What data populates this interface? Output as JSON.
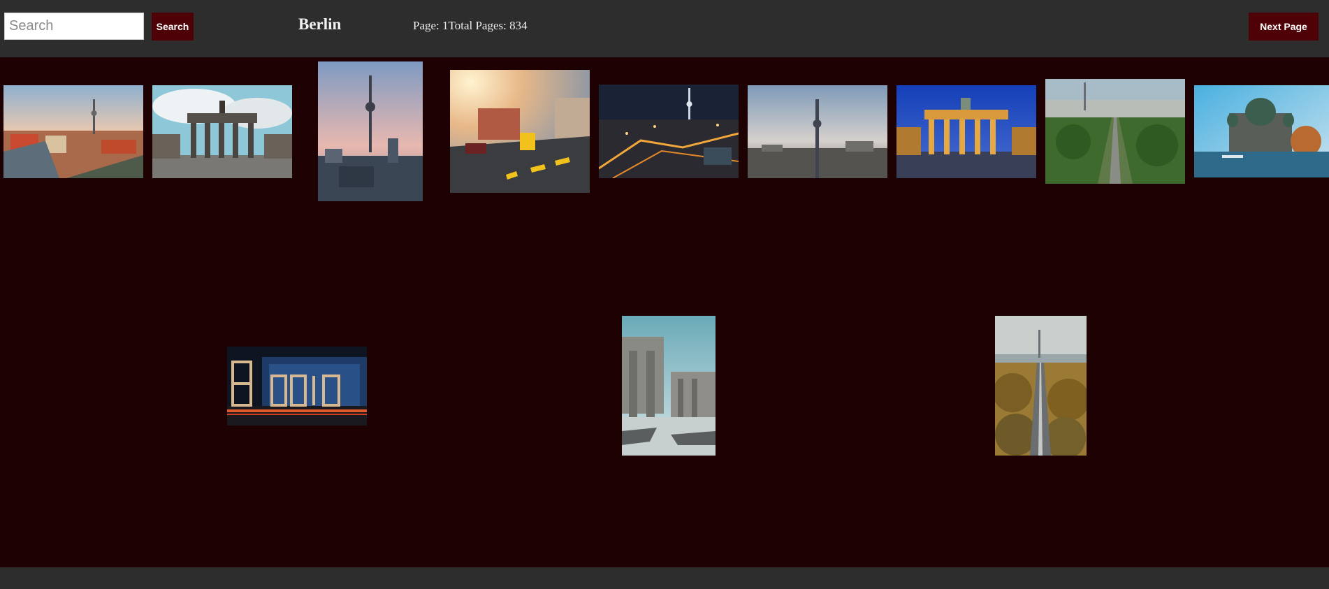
{
  "header": {
    "search": {
      "placeholder": "Search",
      "value": ""
    },
    "search_button": "Search",
    "title": "Berlin",
    "page_label": "Page: ",
    "page_number": "1",
    "total_label": "Total Pages: ",
    "total_pages": "834",
    "next_button": "Next Page"
  },
  "colors": {
    "header_bg": "#2d2d2d",
    "page_bg": "#1e0203",
    "button_bg": "#4e0106"
  },
  "gallery": {
    "photos": [
      {
        "subject": "berlin-skyline-tv-tower-river"
      },
      {
        "subject": "brandenburg-gate-daylight"
      },
      {
        "subject": "tv-tower-sunset-portrait"
      },
      {
        "subject": "street-tram-sunset"
      },
      {
        "subject": "berlin-night-aerial"
      },
      {
        "subject": "tv-tower-cityscape"
      },
      {
        "subject": "brandenburg-gate-night"
      },
      {
        "subject": "tiergarten-aerial-tv-tower"
      },
      {
        "subject": "berlin-cathedral-river"
      },
      {
        "subject": "berlin-letters-night"
      },
      {
        "subject": "brandenburg-gate-columns-portrait"
      },
      {
        "subject": "tiergarten-autumn-road-portrait"
      }
    ]
  }
}
